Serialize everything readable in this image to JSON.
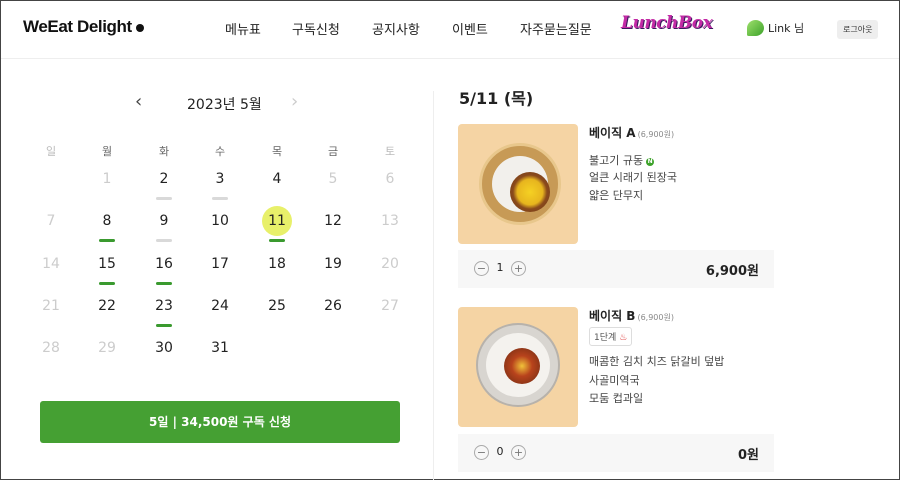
{
  "header": {
    "logo": "WeEat Delight",
    "nav": [
      "메뉴표",
      "구독신청",
      "공지사항",
      "이벤트",
      "자주묻는질문"
    ],
    "lunchbox": "LunchBox",
    "user": "Link 님",
    "logout": "로그아웃"
  },
  "calendar": {
    "title": "2023년 5월",
    "prev_icon": "chevron-left-icon",
    "next_icon": "chevron-right-icon",
    "weekdays": [
      "일",
      "월",
      "화",
      "수",
      "목",
      "금",
      "토"
    ],
    "weeks": [
      [
        "",
        "1",
        "2",
        "3",
        "4",
        "5",
        "6"
      ],
      [
        "7",
        "8",
        "9",
        "10",
        "11",
        "12",
        "13"
      ],
      [
        "14",
        "15",
        "16",
        "17",
        "18",
        "19",
        "20"
      ],
      [
        "21",
        "22",
        "23",
        "24",
        "25",
        "26",
        "27"
      ],
      [
        "28",
        "29",
        "30",
        "31",
        "",
        "",
        ""
      ]
    ],
    "selected_day": "11",
    "subscribed_days": [
      "8",
      "11",
      "15",
      "16",
      "23"
    ],
    "available_days": [
      "2",
      "3",
      "9"
    ],
    "muted_days": [
      "1",
      "5",
      "6",
      "7",
      "13",
      "14",
      "20",
      "21",
      "27",
      "28",
      "29"
    ],
    "subscribe_button": "5일 | 34,500원 구독 신청"
  },
  "menu": {
    "date_title": "5/11 (목)",
    "items": [
      {
        "name": "베이직 A",
        "price": "(6,900원)",
        "dishes": [
          "불고기 규동",
          "얼큰 시래기 된장국",
          "얇은 단무지"
        ],
        "quantity": "1",
        "total": "6,900원"
      },
      {
        "name": "베이직 B",
        "price": "(6,900원)",
        "level": "1단계",
        "dishes": [
          "매콤한 김치 치즈 닭갈비 덮밥",
          "사골미역국",
          "모둠 컵과일"
        ],
        "quantity": "0",
        "total": "0원"
      }
    ]
  },
  "colors": {
    "primary_green": "#45a033",
    "selected_day": "#e8f06a",
    "lunchbox_pink": "#c32ba6"
  }
}
